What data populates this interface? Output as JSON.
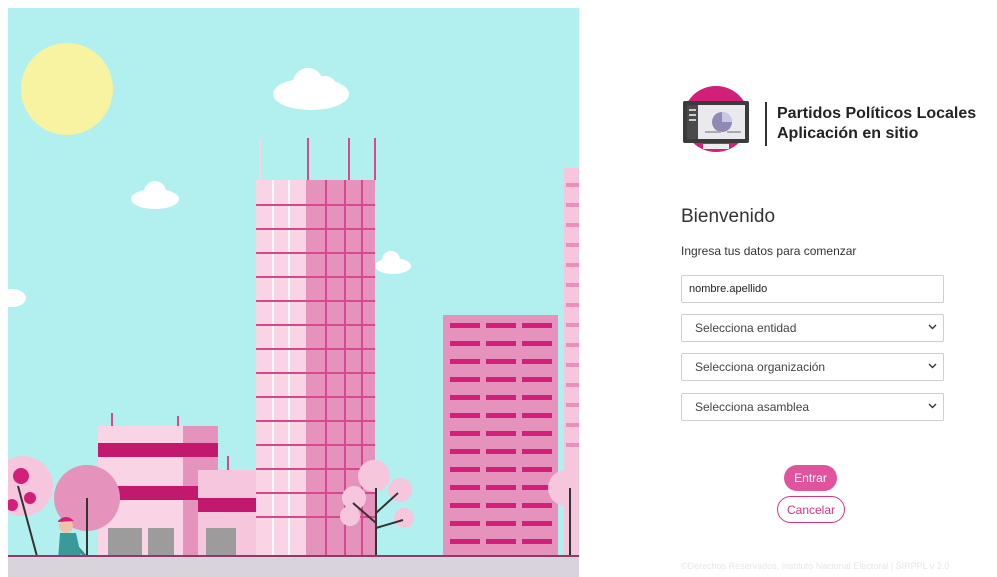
{
  "app": {
    "title_line1": "Partidos Políticos Locales",
    "title_line2": "Aplicación en sitio"
  },
  "login": {
    "welcome": "Bienvenido",
    "subtitle": "Ingresa tus datos para comenzar",
    "username_value": "nombre.apellido",
    "entity_select": "Selecciona entidad",
    "organization_select": "Selecciona organización",
    "assembly_select": "Selecciona asamblea",
    "submit_label": "Entrar",
    "cancel_label": "Cancelar"
  },
  "footer": {
    "text": "©Derechos Reservados, Instituto Nacional Electoral | SIRPPL v 2.0"
  },
  "colors": {
    "brand_pink": "#e0539d",
    "sky": "#b2f0ef",
    "sun": "#f8f3a0"
  },
  "icons": {
    "select_chevron": "chevron-down-icon",
    "brand_logo": "monitor-pie-chart-logo"
  }
}
